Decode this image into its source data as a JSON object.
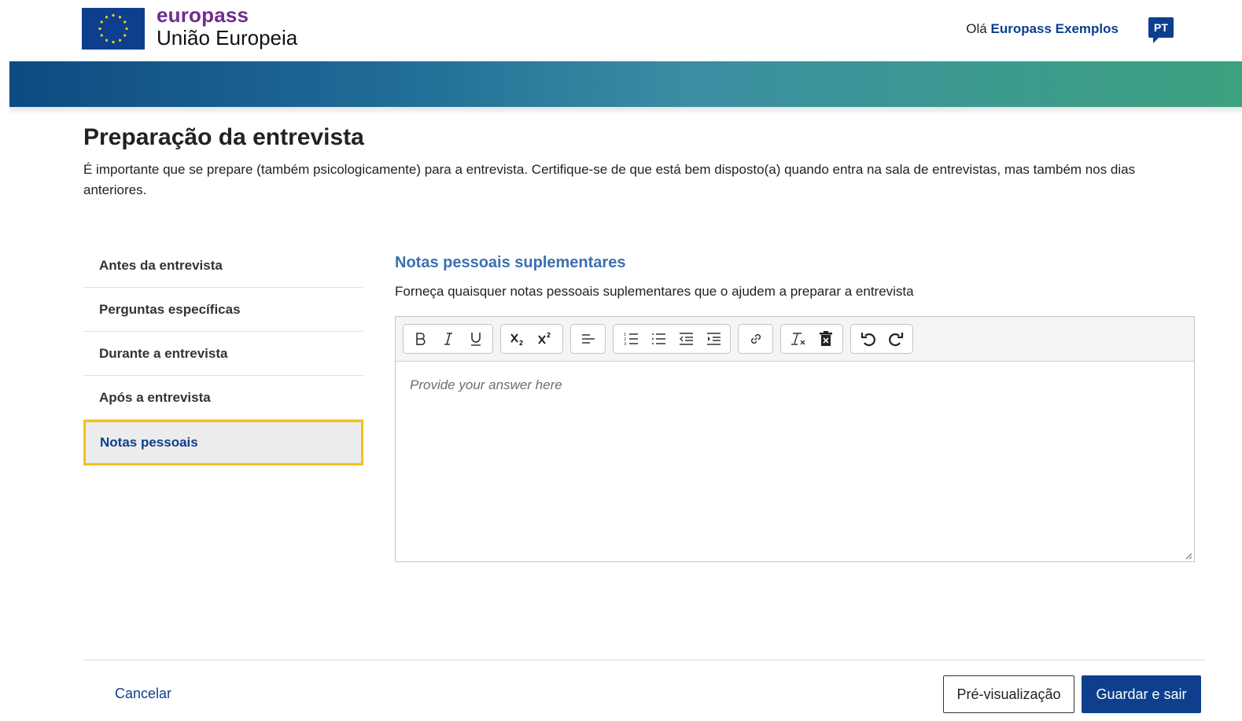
{
  "header": {
    "brand_name": "europass",
    "brand_sub": "União Europeia",
    "greeting_prefix": "Olá",
    "user_name": "Europass Exemplos",
    "language": "PT"
  },
  "page": {
    "title": "Preparação da entrevista",
    "intro": "É importante que se prepare (também psicologicamente) para a entrevista. Certifique-se de que está bem disposto(a) quando entra na sala de entrevistas, mas também nos dias anteriores."
  },
  "sidenav": {
    "items": [
      {
        "label": "Antes da entrevista"
      },
      {
        "label": "Perguntas específicas"
      },
      {
        "label": "Durante a entrevista"
      },
      {
        "label": "Após a entrevista"
      },
      {
        "label": "Notas pessoais"
      }
    ],
    "active": "Notas pessoais"
  },
  "main": {
    "section_title": "Notas pessoais suplementares",
    "section_desc": "Forneça quaisquer notas pessoais suplementares que o ajudem a preparar a entrevista",
    "editor": {
      "placeholder": "Provide your answer here",
      "value": "",
      "toolbar": [
        "bold-icon",
        "italic-icon",
        "underline-icon",
        "subscript-icon",
        "superscript-icon",
        "align-left-icon",
        "ordered-list-icon",
        "bullet-list-icon",
        "outdent-icon",
        "indent-icon",
        "link-icon",
        "clear-format-icon",
        "delete-icon",
        "undo-icon",
        "redo-icon"
      ]
    }
  },
  "footer": {
    "cancel": "Cancelar",
    "preview": "Pré-visualização",
    "save": "Guardar e sair"
  },
  "colors": {
    "primary": "#0e3f8e",
    "brand_purple": "#6f2c91",
    "section_title": "#3a70b0",
    "active_border": "#f0c21b"
  }
}
